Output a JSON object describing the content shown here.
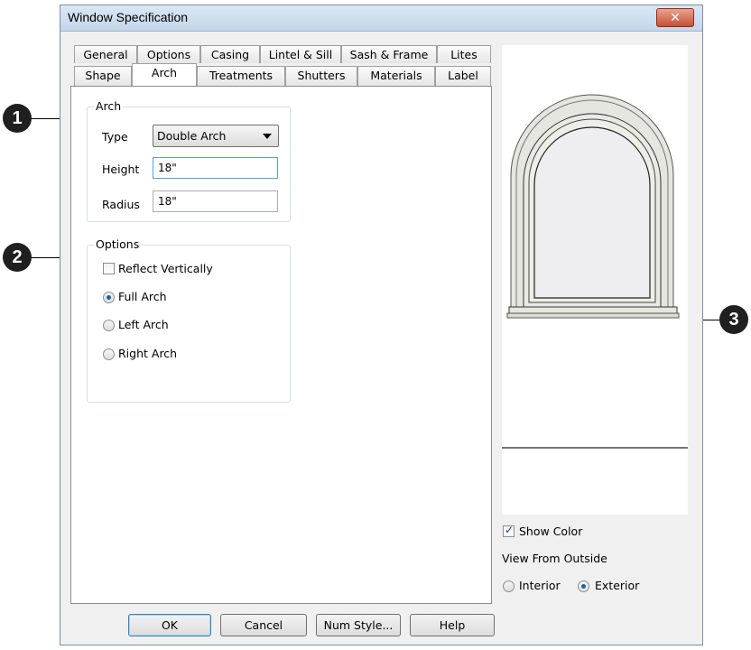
{
  "window": {
    "title": "Window Specification",
    "close_label": "✕"
  },
  "tabs_row1": [
    "General",
    "Options",
    "Casing",
    "Lintel & Sill",
    "Sash & Frame",
    "Lites"
  ],
  "tabs_row2": [
    "Shape",
    "Arch",
    "Treatments",
    "Shutters",
    "Materials",
    "Label"
  ],
  "active_tab": "Arch",
  "arch_group": {
    "label": "Arch",
    "type_label": "Type",
    "type_value": "Double Arch",
    "height_label": "Height",
    "height_value": "18\"",
    "radius_label": "Radius",
    "radius_value": "18\""
  },
  "options_group": {
    "label": "Options",
    "reflect_label": "Reflect Vertically",
    "reflect_checked": false,
    "full_arch_label": "Full Arch",
    "left_arch_label": "Left Arch",
    "right_arch_label": "Right Arch",
    "selected": "Full Arch"
  },
  "preview_panel": {
    "show_color_label": "Show Color",
    "show_color_checked": true,
    "view_label": "View From Outside",
    "interior_label": "Interior",
    "exterior_label": "Exterior",
    "selected_view": "Exterior"
  },
  "buttons": {
    "ok": "OK",
    "cancel": "Cancel",
    "num_style": "Num Style...",
    "help": "Help"
  },
  "callouts": [
    "1",
    "2",
    "3"
  ]
}
